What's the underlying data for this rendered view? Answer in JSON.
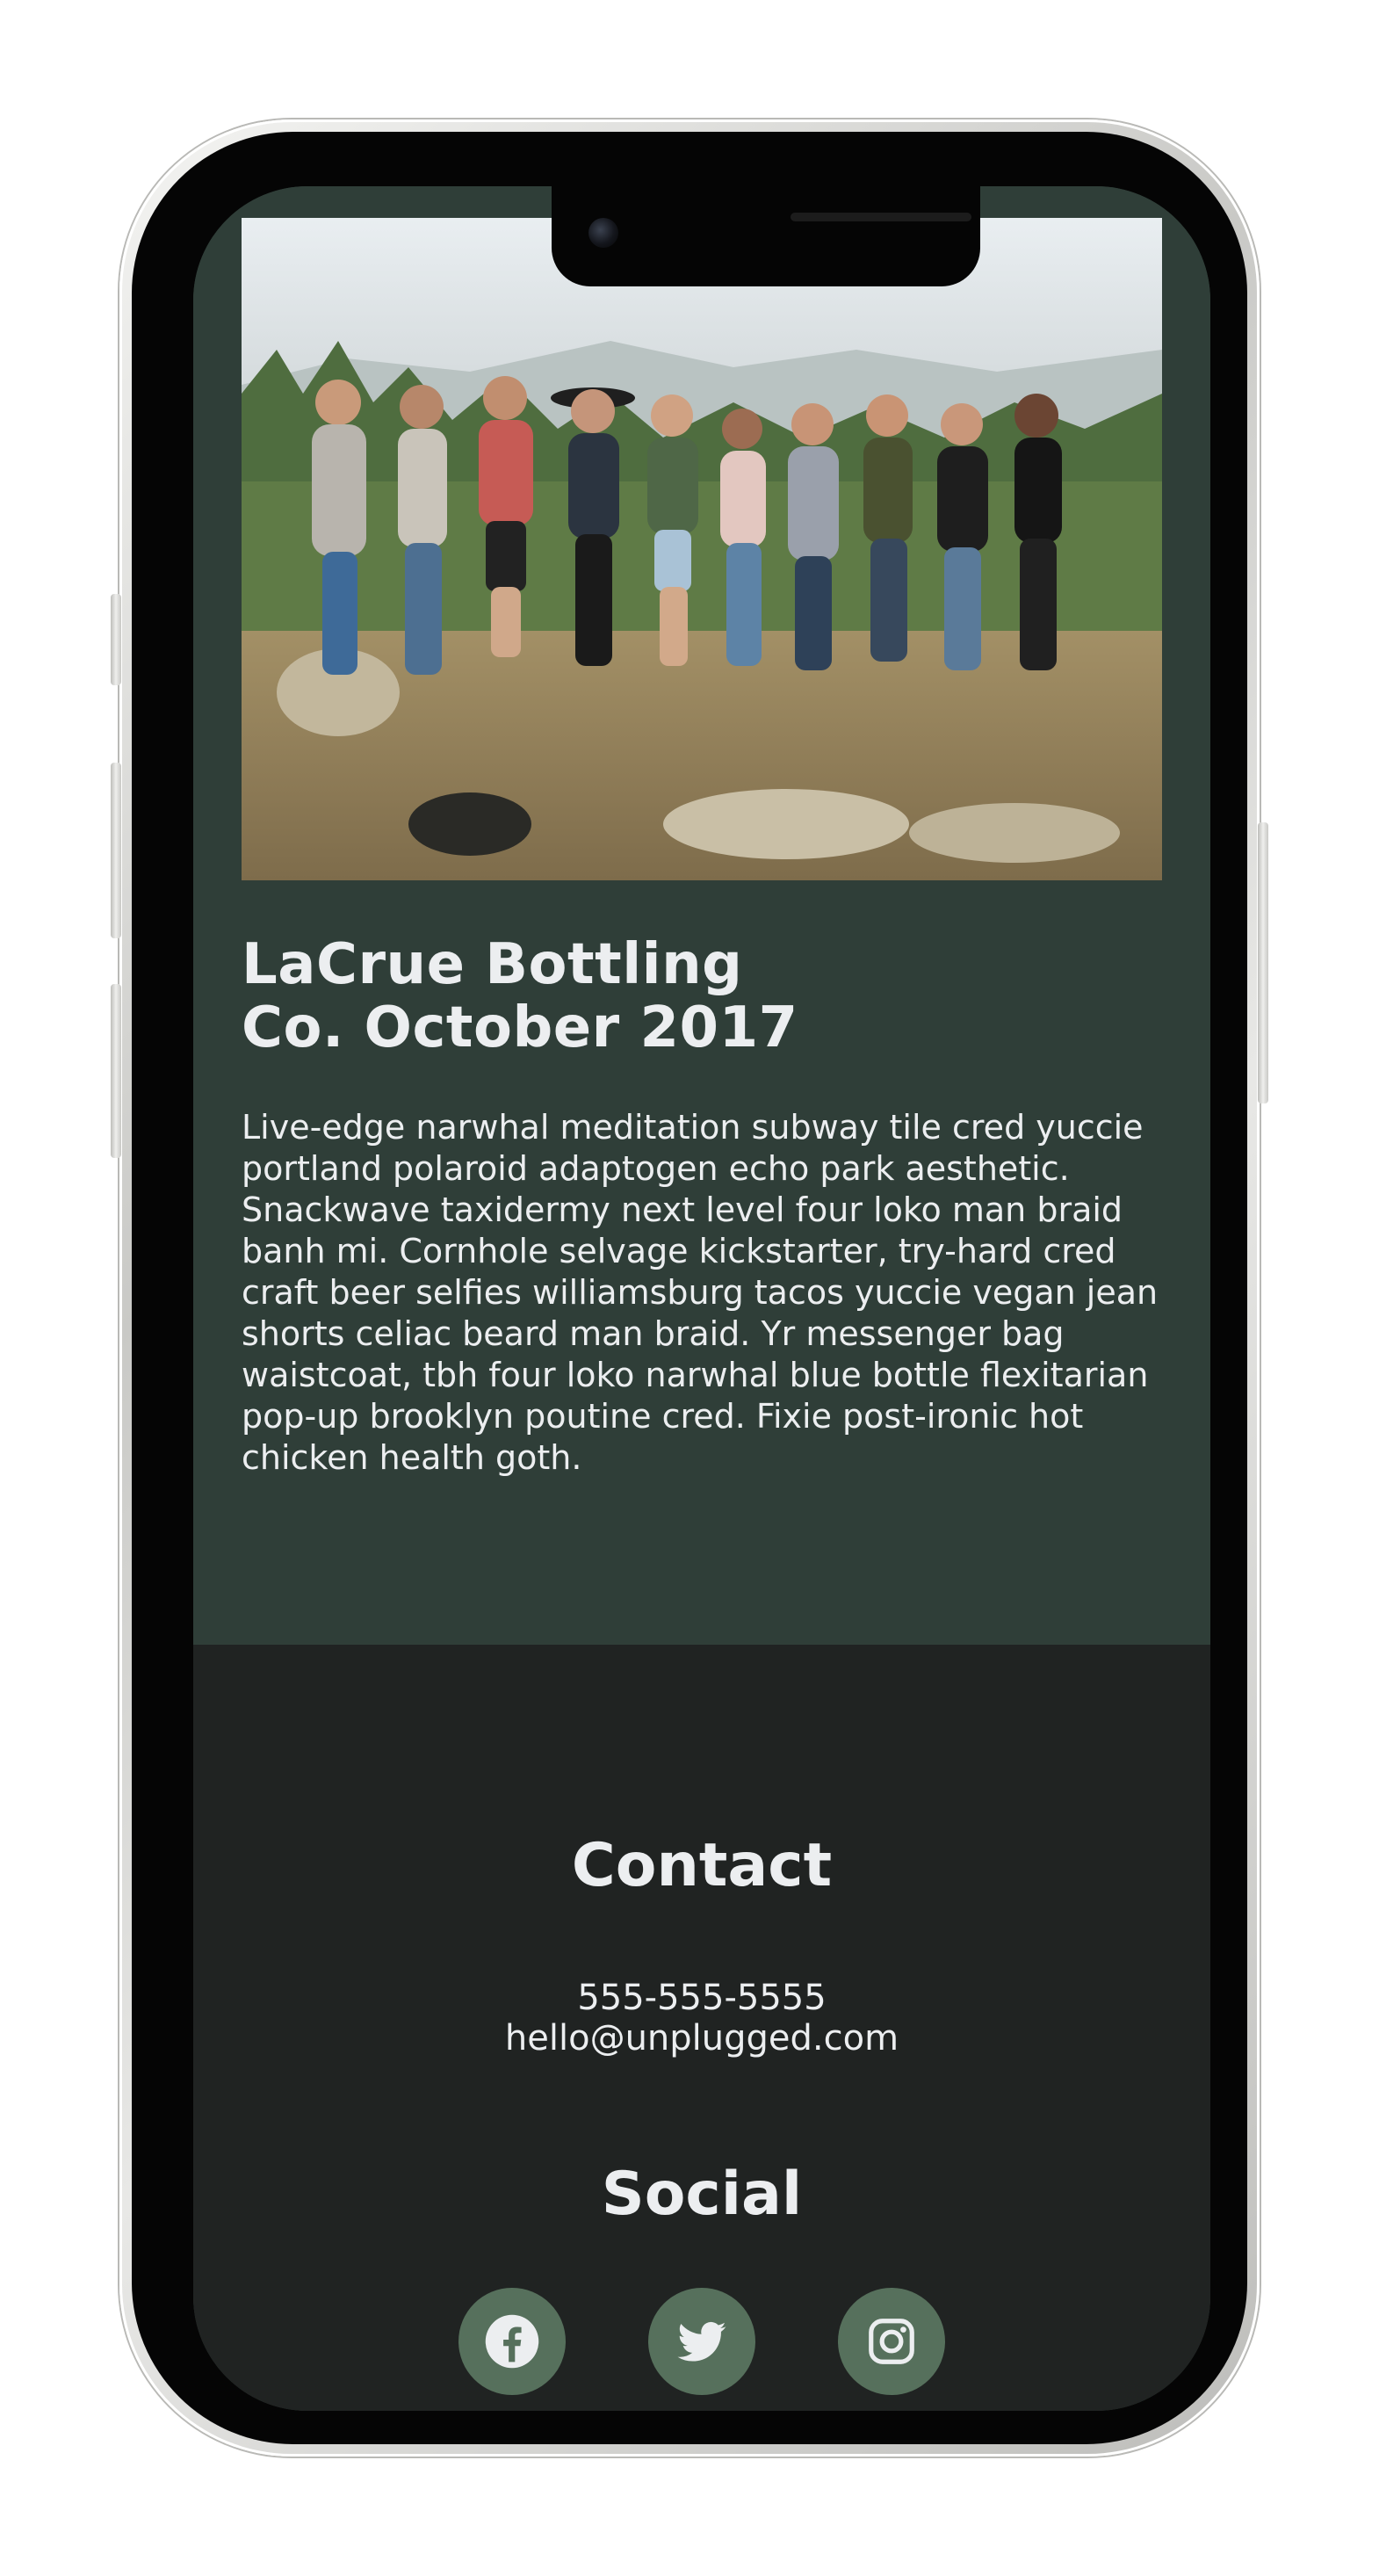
{
  "article": {
    "title_line1": "LaCrue Bottling",
    "title_line2": "Co. October 2017",
    "body": "Live-edge narwhal meditation subway tile cred yuccie portland polaroid adaptogen echo park aesthetic. Snackwave taxidermy next level four loko man braid banh mi. Cornhole selvage kickstarter, try-hard cred craft beer selfies williamsburg tacos yuccie vegan jean shorts celiac beard man braid. Yr messenger bag waistcoat, tbh four loko narwhal blue bottle flexitarian pop-up brooklyn poutine cred. Fixie post-ironic hot chicken health goth.",
    "image": "group-photo"
  },
  "footer": {
    "contact_heading": "Contact",
    "phone": "555-555-5555",
    "email": "hello@unplugged.com",
    "social_heading": "Social",
    "social_icons": [
      "facebook-icon",
      "twitter-icon",
      "instagram-icon"
    ]
  },
  "colors": {
    "content_bg": "#2f3e38",
    "footer_bg": "#202322",
    "social_button_bg": "#56705c",
    "text": "#eceef0"
  }
}
